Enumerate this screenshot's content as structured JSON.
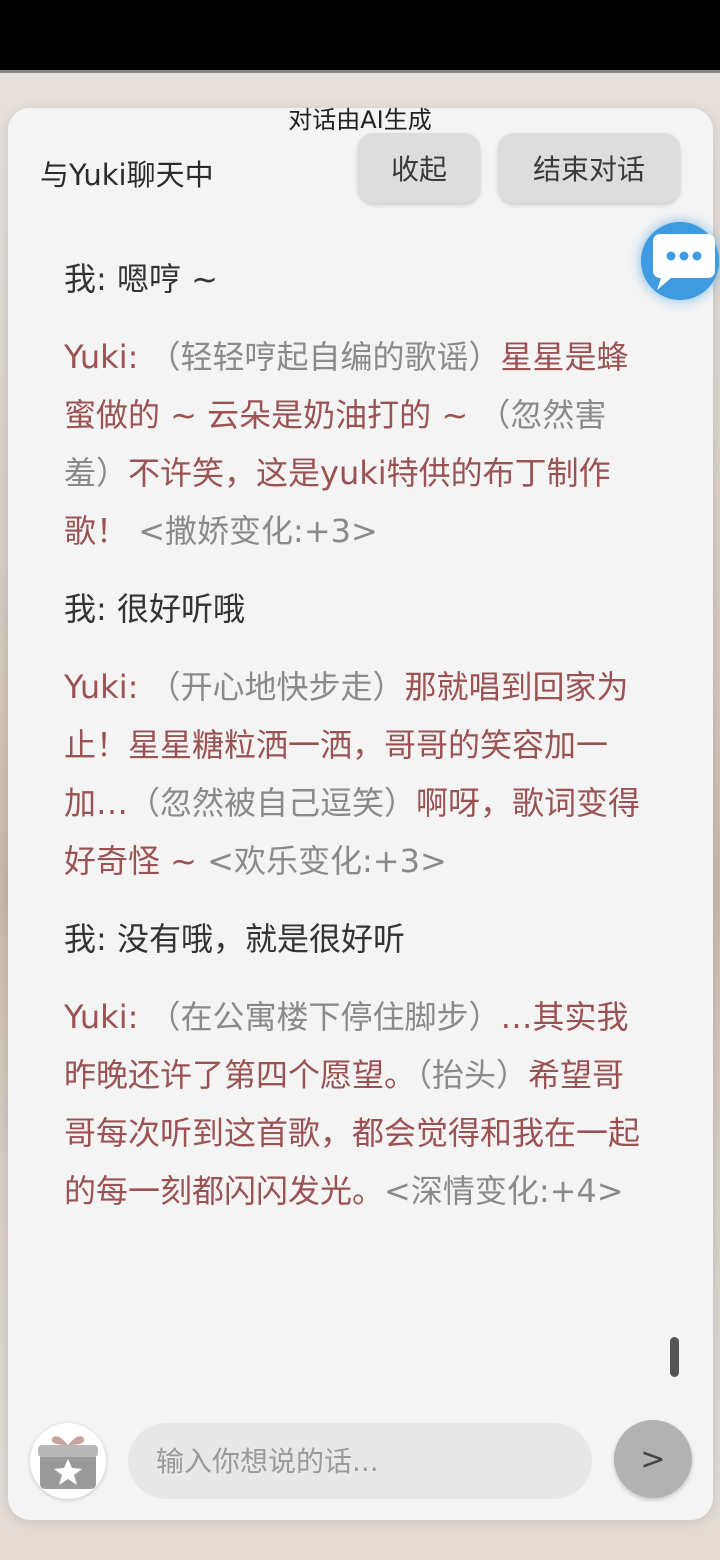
{
  "header": {
    "ai_note": "对话由AI生成",
    "title": "与Yuki聊天中",
    "collapse_label": "收起",
    "end_label": "结束对话"
  },
  "icons": {
    "chat_bubble": "chat-bubble-icon",
    "gift": "gift-star-icon"
  },
  "colors": {
    "user_text": "#333333",
    "bot_text": "#9b5252",
    "muted_text": "#8a8a8a",
    "accent_blue": "#3f9be0"
  },
  "messages": [
    {
      "role": "user",
      "prefix": "我: ",
      "text": "嗯哼 ~"
    },
    {
      "role": "bot",
      "prefix": "Yuki: ",
      "segments": [
        {
          "style": "gray",
          "text": "（轻轻哼起自编的歌谣）"
        },
        {
          "style": "normal",
          "text": "星星是蜂蜜做的 ~ 云朵是奶油打的 ~ "
        },
        {
          "style": "gray",
          "text": "（忽然害羞）"
        },
        {
          "style": "normal",
          "text": "不许笑，这是yuki特供的布丁制作歌！ "
        },
        {
          "style": "gray",
          "text": "<撒娇变化:+3>"
        }
      ]
    },
    {
      "role": "user",
      "prefix": "我: ",
      "text": "很好听哦"
    },
    {
      "role": "bot",
      "prefix": "Yuki: ",
      "segments": [
        {
          "style": "gray",
          "text": "（开心地快步走）"
        },
        {
          "style": "normal",
          "text": "那就唱到回家为止！星星糖粒洒一洒，哥哥的笑容加一加…"
        },
        {
          "style": "gray",
          "text": "（忽然被自己逗笑）"
        },
        {
          "style": "normal",
          "text": "啊呀，歌词变得好奇怪 ~ "
        },
        {
          "style": "gray",
          "text": "<欢乐变化:+3>"
        }
      ]
    },
    {
      "role": "user",
      "prefix": "我: ",
      "text": "没有哦，就是很好听"
    },
    {
      "role": "bot",
      "prefix": "Yuki: ",
      "segments": [
        {
          "style": "gray",
          "text": "（在公寓楼下停住脚步）"
        },
        {
          "style": "normal",
          "text": "…其实我昨晚还许了第四个愿望。"
        },
        {
          "style": "gray",
          "text": "（抬头）"
        },
        {
          "style": "normal",
          "text": "希望哥哥每次听到这首歌，都会觉得和我在一起的每一刻都闪闪发光。"
        },
        {
          "style": "gray",
          "text": "<深情变化:+4>"
        }
      ]
    }
  ],
  "composer": {
    "placeholder": "输入你想说的话...",
    "value": "",
    "send_label": ">"
  }
}
